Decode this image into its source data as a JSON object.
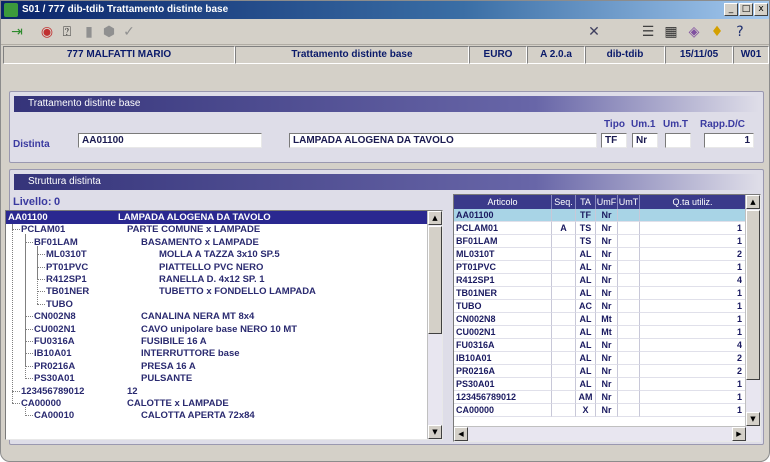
{
  "window": {
    "title": "S01 / 777 dib-tdib Trattamento distinte base",
    "controls": [
      "_",
      "□",
      "x"
    ]
  },
  "toolbar": {
    "left_icons": [
      "exit-icon",
      "globe-icon",
      "help-book-icon",
      "trash-icon",
      "eraser-icon",
      "check-icon"
    ],
    "right_icons": [
      "currency-icon",
      "list-icon",
      "calculator-icon",
      "calendar-icon",
      "bulb-icon",
      "whats-this-icon"
    ]
  },
  "status": {
    "user": "777 MALFATTI MARIO",
    "function": "Trattamento distinte base",
    "currency": "EURO",
    "version": "A 2.0.a",
    "program": "dib-tdib",
    "date": "15/11/05",
    "terminal": "W01"
  },
  "header_panel": {
    "title": "Trattamento distinte base",
    "distinta_label": "Distinta",
    "distinta_code": "AA01100",
    "distinta_desc": "LAMPADA ALOGENA DA TAVOLO",
    "tipo_label": "Tipo",
    "tipo_value": "TF",
    "um1_label": "Um.1",
    "um1_value": "Nr",
    "umt_label": "Um.T",
    "umt_value": "",
    "rapp_label": "Rapp.D/C",
    "rapp_value": "1"
  },
  "structure_panel": {
    "title": "Struttura distinta",
    "livello_label": "Livello:",
    "livello_value": "0",
    "tree": [
      {
        "code": "AA01100",
        "desc": "LAMPADA ALOGENA DA TAVOLO",
        "level": 0
      },
      {
        "code": "PCLAM01",
        "desc": "PARTE COMUNE x LAMPADE",
        "level": 1
      },
      {
        "code": "BF01LAM",
        "desc": "BASAMENTO x LAMPADE",
        "level": 2
      },
      {
        "code": "ML0310T",
        "desc": "MOLLA A TAZZA 3x10 SP.5",
        "level": 3
      },
      {
        "code": "PT01PVC",
        "desc": "PIATTELLO PVC NERO",
        "level": 3
      },
      {
        "code": "R412SP1",
        "desc": "RANELLA D. 4x12 SP. 1",
        "level": 3
      },
      {
        "code": "TB01NER",
        "desc": "TUBETTO x FONDELLO LAMPADA",
        "level": 3
      },
      {
        "code": "TUBO",
        "desc": "",
        "level": 3
      },
      {
        "code": "CN002N8",
        "desc": "CANALINA NERA  MT 8x4",
        "level": 2
      },
      {
        "code": "CU002N1",
        "desc": "CAVO unipolare base NERO  10 MT",
        "level": 2
      },
      {
        "code": "FU0316A",
        "desc": "FUSIBILE 16 A",
        "level": 2
      },
      {
        "code": "IB10A01",
        "desc": "INTERRUTTORE base",
        "level": 2
      },
      {
        "code": "PR0216A",
        "desc": "PRESA 16 A",
        "level": 2
      },
      {
        "code": "PS30A01",
        "desc": "PULSANTE",
        "level": 2
      },
      {
        "code": "123456789012",
        "desc": "12",
        "level": 1
      },
      {
        "code": "CA00000",
        "desc": "CALOTTE x LAMPADE",
        "level": 1
      },
      {
        "code": "CA00010",
        "desc": "CALOTTA APERTA 72x84",
        "level": 2
      }
    ]
  },
  "grid": {
    "headers": [
      "Articolo",
      "Seq.",
      "TA",
      "UmF",
      "UmT",
      "Q.ta utiliz."
    ],
    "rows": [
      [
        "AA01100",
        "",
        "TF",
        "Nr",
        "",
        ""
      ],
      [
        "PCLAM01",
        "A",
        "TS",
        "Nr",
        "",
        "1"
      ],
      [
        "BF01LAM",
        "",
        "TS",
        "Nr",
        "",
        "1"
      ],
      [
        "ML0310T",
        "",
        "AL",
        "Nr",
        "",
        "2"
      ],
      [
        "PT01PVC",
        "",
        "AL",
        "Nr",
        "",
        "1"
      ],
      [
        "R412SP1",
        "",
        "AL",
        "Nr",
        "",
        "4"
      ],
      [
        "TB01NER",
        "",
        "AL",
        "Nr",
        "",
        "1"
      ],
      [
        "TUBO",
        "",
        "AC",
        "Nr",
        "",
        "1"
      ],
      [
        "CN002N8",
        "",
        "AL",
        "Mt",
        "",
        "1"
      ],
      [
        "CU002N1",
        "",
        "AL",
        "Mt",
        "",
        "1"
      ],
      [
        "FU0316A",
        "",
        "AL",
        "Nr",
        "",
        "4"
      ],
      [
        "IB10A01",
        "",
        "AL",
        "Nr",
        "",
        "2"
      ],
      [
        "PR0216A",
        "",
        "AL",
        "Nr",
        "",
        "2"
      ],
      [
        "PS30A01",
        "",
        "AL",
        "Nr",
        "",
        "1"
      ],
      [
        "123456789012",
        "",
        "AM",
        "Nr",
        "",
        "1"
      ],
      [
        "CA00000",
        "",
        "X",
        "Nr",
        "",
        "1"
      ]
    ]
  },
  "colors": {
    "title_bar": "#0a246a",
    "panel_head": "#35347a",
    "tree_selection": "#2a2890",
    "grid_header": "#3a3a8a",
    "grid_selection": "#a8d4e6"
  }
}
